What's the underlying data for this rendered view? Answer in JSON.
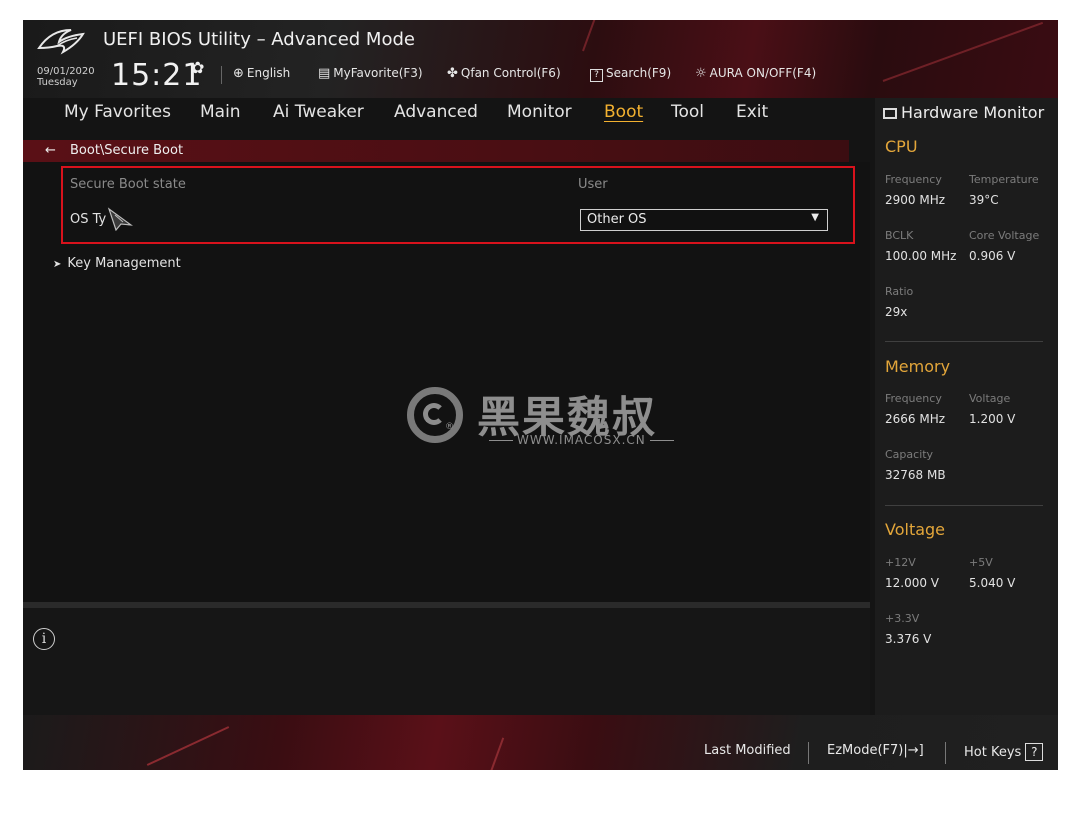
{
  "header": {
    "app_title": "UEFI BIOS Utility – Advanced Mode",
    "date": "09/01/2020",
    "weekday": "Tuesday",
    "time": "15:21",
    "tools": [
      {
        "icon": "globe-icon",
        "label": "English"
      },
      {
        "icon": "favorite-list-icon",
        "label": "MyFavorite(F3)"
      },
      {
        "icon": "fan-icon",
        "label": "Qfan Control(F6)"
      },
      {
        "icon": "help-box-icon",
        "label": "Search(F9)"
      },
      {
        "icon": "aura-light-icon",
        "label": "AURA ON/OFF(F4)"
      }
    ]
  },
  "tabs": [
    {
      "label": "My Favorites",
      "active": false
    },
    {
      "label": "Main",
      "active": false
    },
    {
      "label": "Ai Tweaker",
      "active": false
    },
    {
      "label": "Advanced",
      "active": false
    },
    {
      "label": "Monitor",
      "active": false
    },
    {
      "label": "Boot",
      "active": true
    },
    {
      "label": "Tool",
      "active": false
    },
    {
      "label": "Exit",
      "active": false
    }
  ],
  "breadcrumb": {
    "path": "Boot\\Secure Boot"
  },
  "secure_boot": {
    "state_label": "Secure Boot state",
    "state_value": "User",
    "os_type_label": "OS Ty",
    "os_type_value": "Other OS"
  },
  "submenu": {
    "key_management": "Key Management"
  },
  "watermark": {
    "text": "黑果魏叔",
    "url": "WWW.IMACOSX.CN",
    "reg": "®"
  },
  "hardware_monitor": {
    "title": "Hardware Monitor",
    "cpu": {
      "title": "CPU",
      "frequency_label": "Frequency",
      "frequency": "2900 MHz",
      "temperature_label": "Temperature",
      "temperature": "39°C",
      "bclk_label": "BCLK",
      "bclk": "100.00 MHz",
      "core_voltage_label": "Core Voltage",
      "core_voltage": "0.906 V",
      "ratio_label": "Ratio",
      "ratio": "29x"
    },
    "memory": {
      "title": "Memory",
      "frequency_label": "Frequency",
      "frequency": "2666 MHz",
      "voltage_label": "Voltage",
      "voltage": "1.200 V",
      "capacity_label": "Capacity",
      "capacity": "32768 MB"
    },
    "voltage": {
      "title": "Voltage",
      "v12_label": "+12V",
      "v12": "12.000 V",
      "v5_label": "+5V",
      "v5": "5.040 V",
      "v33_label": "+3.3V",
      "v33": "3.376 V"
    }
  },
  "footer": {
    "last_modified": "Last Modified",
    "ezmode": "EzMode(F7)|→]",
    "hot_keys": "Hot Keys",
    "hot_keys_icon": "?"
  },
  "colors": {
    "accent": "#f3b130",
    "highlight": "#d8121c",
    "brand_red": "#5a1016"
  }
}
